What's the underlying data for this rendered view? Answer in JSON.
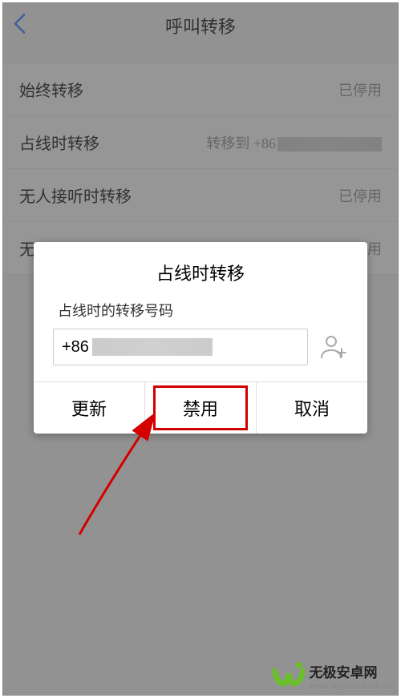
{
  "header": {
    "title": "呼叫转移"
  },
  "settings": [
    {
      "label": "始终转移",
      "value": "已停用"
    },
    {
      "label": "占线时转移",
      "value": "转移到 +86"
    },
    {
      "label": "无人接听时转移",
      "value": "已停用"
    },
    {
      "label": "无",
      "value": "用"
    }
  ],
  "dialog": {
    "title": "占线时转移",
    "subtitle": "占线时的转移号码",
    "input_prefix": "+86",
    "buttons": {
      "update": "更新",
      "disable": "禁用",
      "cancel": "取消"
    }
  },
  "watermark": {
    "title": "无极安卓网",
    "url": "www.wjhotel.com.cn"
  }
}
